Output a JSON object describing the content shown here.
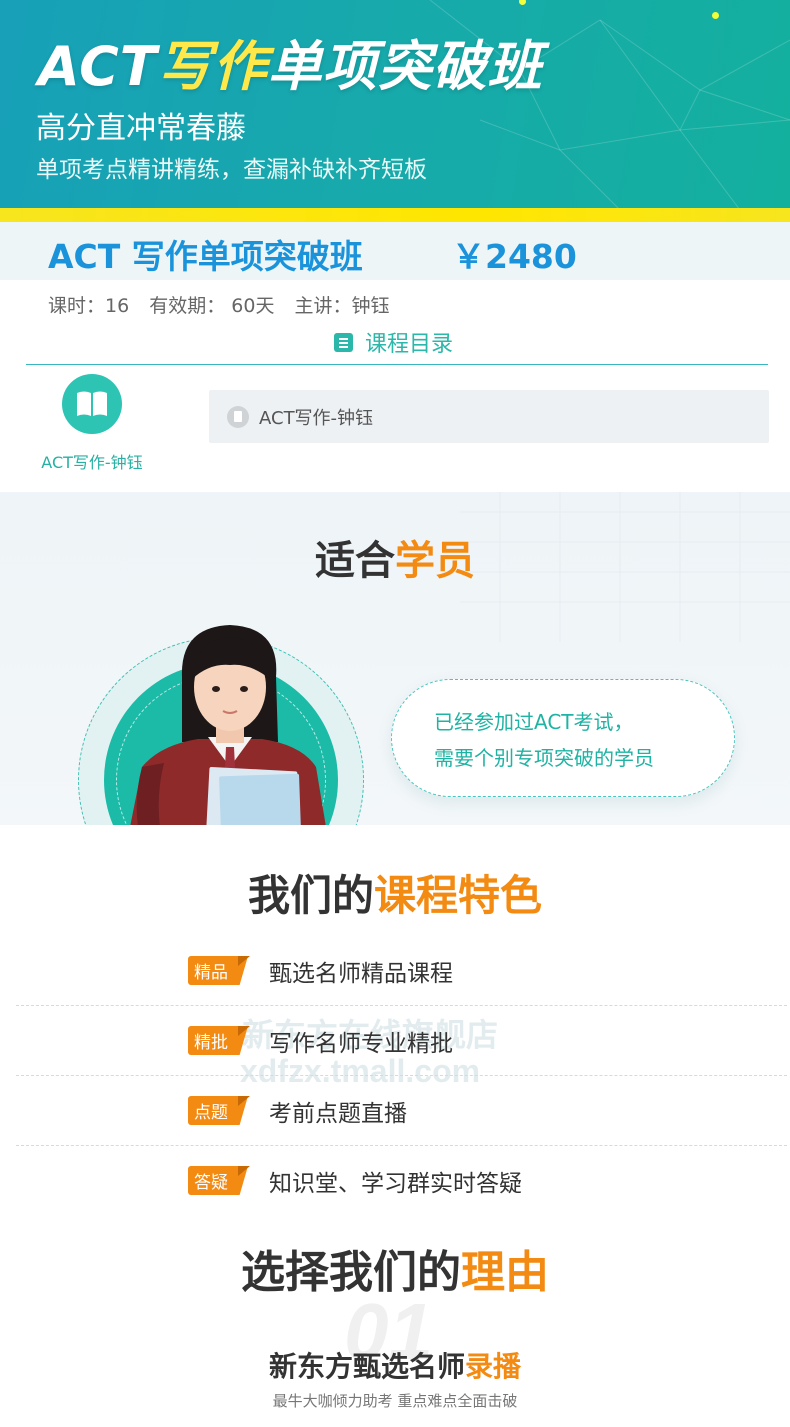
{
  "banner": {
    "title_prefix": "ACT",
    "title_highlight": "写作",
    "title_suffix": "单项突破班",
    "subtitle": "高分直冲常春藤",
    "tagline": "单项考点精讲精练，查漏补缺补齐短板"
  },
  "course": {
    "name": "ACT 写作单项突破班",
    "price": "￥2480",
    "hours": "课时：16",
    "validity": "有效期： 60天",
    "teacher": "主讲：钟钰",
    "catalog_label": "课程目录",
    "lesson_card_label": "ACT写作-钟钰",
    "lesson_row_label": "ACT写作-钟钰"
  },
  "students": {
    "title_dark": "适合",
    "title_orange": "学员",
    "bubble_line1": "已经参加过ACT考试，",
    "bubble_line2": "需要个别专项突破的学员"
  },
  "features": {
    "title_dark": "我们的",
    "title_orange": "课程特色",
    "items": [
      {
        "tag": "精品",
        "text": "甄选名师精品课程"
      },
      {
        "tag": "精批",
        "text": "写作名师专业精批"
      },
      {
        "tag": "点题",
        "text": "考前点题直播"
      },
      {
        "tag": "答疑",
        "text": "知识堂、学习群实时答疑"
      }
    ],
    "watermark_line1": "新东方在线旗舰店",
    "watermark_line2": "xdfzx.tmall.com"
  },
  "reasons": {
    "title_dark": "选择我们的",
    "title_orange": "理由",
    "number": "01",
    "item_title_dark": "新东方甄选名师",
    "item_title_orange": "录播",
    "item_subtitle": "最牛大咖倾力助考 重点难点全面击破"
  },
  "colors": {
    "accent_blue": "#1a93db",
    "accent_teal": "#2bb7a9",
    "accent_orange": "#f38a12",
    "banner_yellow": "#ffe94a"
  }
}
